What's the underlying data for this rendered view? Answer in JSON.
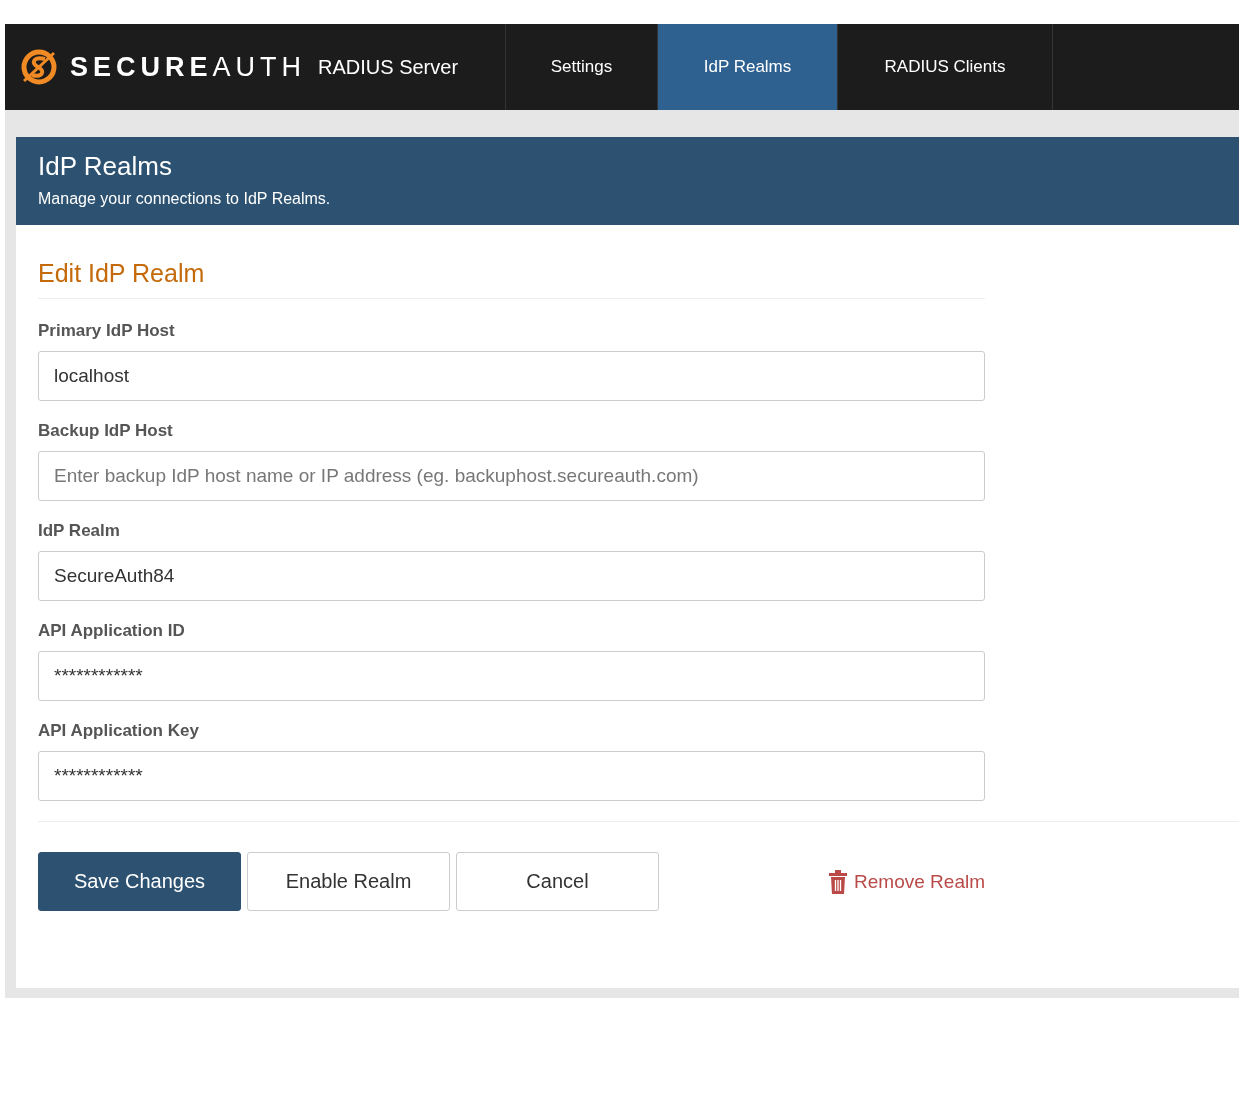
{
  "brand": {
    "logo_text": "**SECURE**AUTH",
    "product": "RADIUS Server"
  },
  "nav": [
    {
      "label": "Settings",
      "selected": false
    },
    {
      "label": "IdP Realms",
      "selected": true
    },
    {
      "label": "RADIUS Clients",
      "selected": false
    }
  ],
  "page_header": {
    "title": "IdP Realms",
    "subtitle": "Manage your connections to IdP Realms."
  },
  "form": {
    "title": "Edit IdP Realm",
    "fields": [
      {
        "label": "Primary IdP Host",
        "value": "localhost"
      },
      {
        "label": "Backup IdP Host",
        "placeholder": "Enter backup IdP host name or IP address (eg. backuphost.secureauth.com)"
      },
      {
        "label": "IdP Realm",
        "value": "SecureAuth84"
      },
      {
        "label": "API Application ID",
        "value": "************"
      },
      {
        "label": "API Application Key",
        "value": "************"
      }
    ]
  },
  "buttons": [
    {
      "label": "Save Changes",
      "kind": "primary"
    },
    {
      "label": "Enable Realm",
      "kind": "default"
    },
    {
      "label": "Cancel",
      "kind": "default"
    }
  ],
  "remove_link": "Remove Realm"
}
